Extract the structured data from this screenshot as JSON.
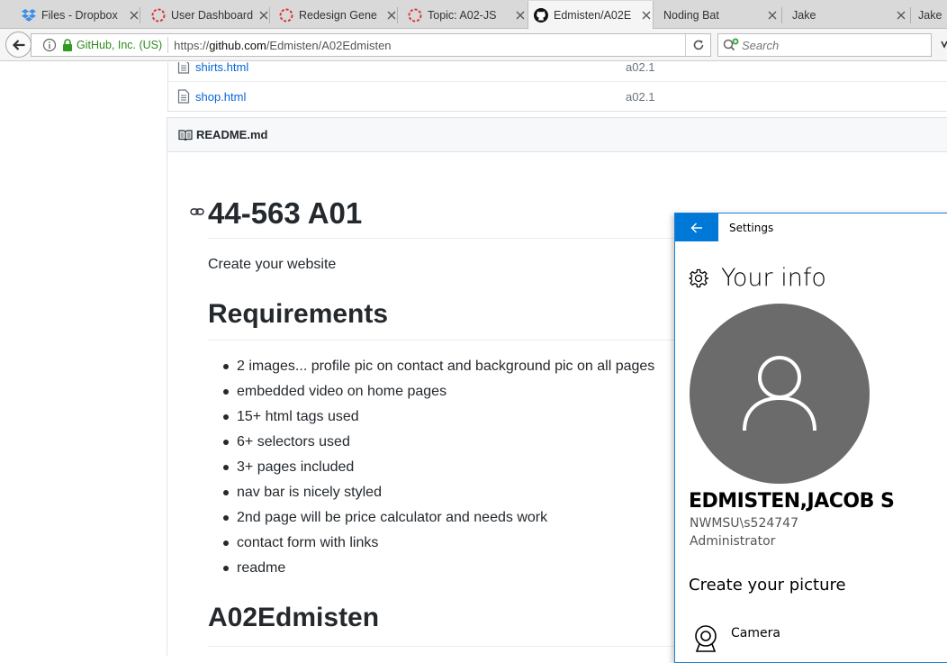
{
  "tabs": [
    {
      "label": "Files - Dropbox",
      "icon": "dropbox-icon"
    },
    {
      "label": "User Dashboard",
      "icon": "loading-icon"
    },
    {
      "label": "Redesign Gene",
      "icon": "loading-icon"
    },
    {
      "label": "Topic: A02-JS",
      "icon": "loading-icon"
    },
    {
      "label": "Edmisten/A02E",
      "icon": "github-icon"
    },
    {
      "label": "Noding Bat",
      "icon": ""
    },
    {
      "label": "Jake",
      "icon": ""
    },
    {
      "label": "Jake",
      "icon": ""
    }
  ],
  "navbar": {
    "org": "GitHub, Inc. (US)",
    "url_prefix": "https://",
    "url_host": "github.com",
    "url_path": "/Edmisten/A02Edmisten",
    "search_placeholder": "Search"
  },
  "files": [
    {
      "name": "shirts.html",
      "message": "a02.1"
    },
    {
      "name": "shop.html",
      "message": "a02.1"
    }
  ],
  "readme": {
    "filename": "README.md",
    "title": "44-563 A01",
    "description": "Create your website",
    "requirements_heading": "Requirements",
    "requirements": [
      "2 images... profile pic on contact and background pic on all pages",
      "embedded video on home pages",
      "15+ html tags used",
      "6+ selectors used",
      "3+ pages included",
      "nav bar is nicely styled",
      "2nd page will be price calculator and needs work",
      "contact form with links",
      "readme"
    ],
    "second_heading": "A02Edmisten"
  },
  "settings": {
    "window_title": "Settings",
    "heading": "Your info",
    "user_name": "EDMISTEN,JACOB S",
    "account": "NWMSU\\s524747",
    "role": "Administrator",
    "create_picture": "Create your picture",
    "camera_label": "Camera",
    "accent_color": "#0078d7"
  }
}
